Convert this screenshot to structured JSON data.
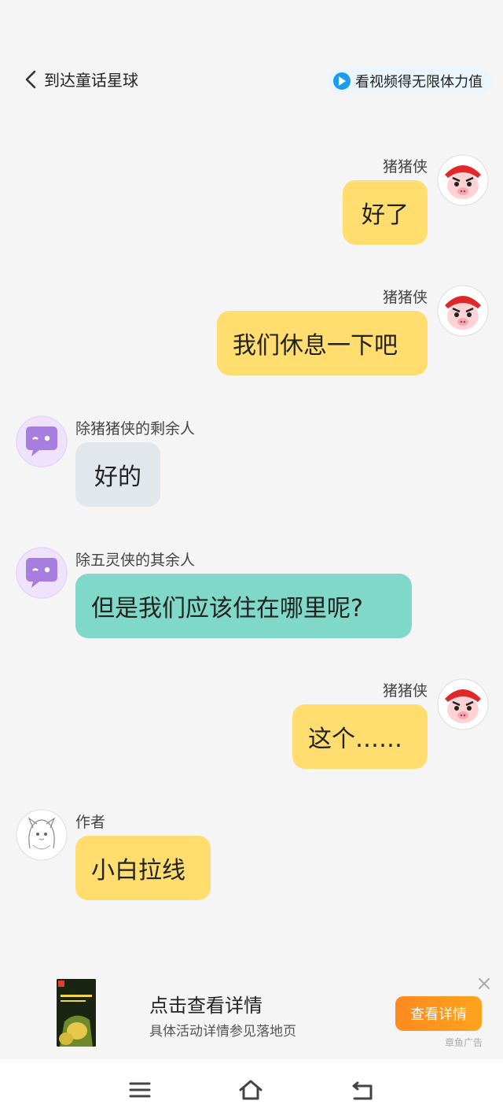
{
  "header": {
    "back_title": "到达童话星球",
    "video_reward": "看视频得无限体力值"
  },
  "messages": [
    {
      "sender": "猪猪侠",
      "text": "好了",
      "side": "right",
      "color": "#ffdd6e",
      "avatar": "pig-hero-avatar"
    },
    {
      "sender": "猪猪侠",
      "text": "我们休息一下吧",
      "side": "right",
      "color": "#ffdd6e",
      "avatar": "pig-hero-avatar"
    },
    {
      "sender": "除猪猪侠的剩余人",
      "text": "好的",
      "side": "left",
      "color": "#e2e6ed",
      "avatar": "chat-bubble-avatar"
    },
    {
      "sender": "除五灵侠的其余人",
      "text": "但是我们应该住在哪里呢?",
      "side": "left",
      "color": "#7fd8c8",
      "avatar": "chat-bubble-avatar"
    },
    {
      "sender": "猪猪侠",
      "text": "这个……",
      "side": "right",
      "color": "#ffdd6e",
      "avatar": "pig-hero-avatar"
    },
    {
      "sender": "作者",
      "text": "小白拉线",
      "side": "left",
      "color": "#ffdd6e",
      "avatar": "author-sketch-avatar"
    }
  ],
  "ad": {
    "title": "点击查看详情",
    "subtitle": "具体活动详情参见落地页",
    "button": "查看详情",
    "tag": "章鱼广告"
  },
  "nav": {
    "icons": [
      "menu-icon",
      "home-icon",
      "back-icon"
    ]
  }
}
